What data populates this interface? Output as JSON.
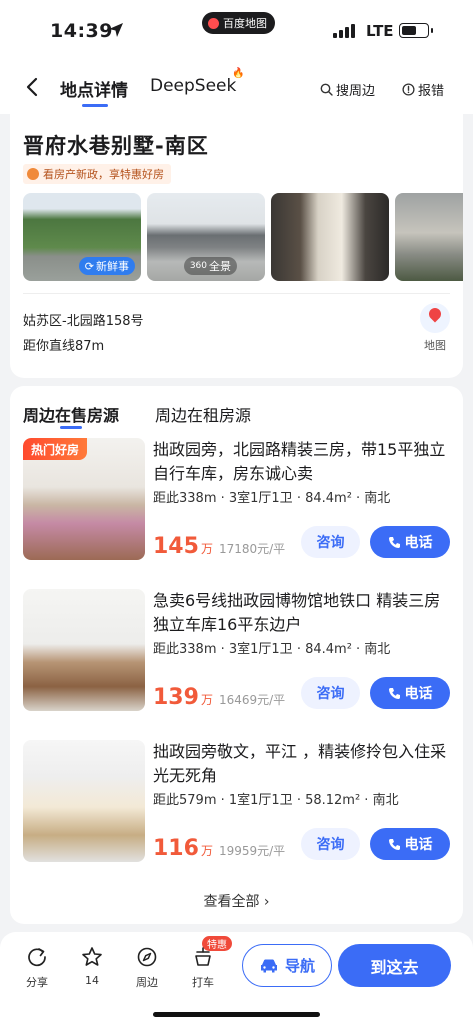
{
  "status_bar": {
    "time": "14:39",
    "app_pill": "百度地图",
    "network": "LTE"
  },
  "nav": {
    "tab_detail": "地点详情",
    "tab_ai": "DeepSeek",
    "search_nearby": "搜周边",
    "report": "报错"
  },
  "place": {
    "title": "晋府水巷别墅-南区",
    "promo": "看房产新政，享特惠好房",
    "photo_badge_fresh": "新鲜事",
    "photo_badge_360": "360",
    "photo_badge_pano": "全景",
    "address": "姑苏区-北园路158号",
    "distance": "距你直线87m",
    "map_label": "地图"
  },
  "listings": {
    "tab_sale": "周边在售房源",
    "tab_rent": "周边在租房源",
    "hot_badge": "热门好房",
    "consult_label": "咨询",
    "call_label": "电话",
    "price_unit": "万",
    "items": [
      {
        "title": "拙政园旁，北园路精装三房，带15平独立自行车库，房东诚心卖",
        "meta": "距此338m · 3室1厅1卫 · 84.4m² · 南北",
        "price": "145",
        "unit_price": "17180元/平"
      },
      {
        "title": "急卖6号线拙政园博物馆地铁口 精装三房 独立车库16平东边户",
        "meta": "距此338m · 3室1厅1卫 · 84.4m² · 南北",
        "price": "139",
        "unit_price": "16469元/平"
      },
      {
        "title": "拙政园旁敬文，平江 ，精装修拎包入住采光无死角",
        "meta": "距此579m · 1室1厅1卫 · 58.12m² · 南北",
        "price": "116",
        "unit_price": "19959元/平"
      }
    ],
    "view_all": "查看全部 ›"
  },
  "bottom_bar": {
    "share": "分享",
    "favorites_count": "14",
    "nearby": "周边",
    "taxi": "打车",
    "special_badge": "特惠",
    "navigate": "导航",
    "go_here": "到这去"
  },
  "colors": {
    "accent": "#3b6cf6",
    "price": "#f15a3a",
    "hot": "#ff4a2e"
  }
}
